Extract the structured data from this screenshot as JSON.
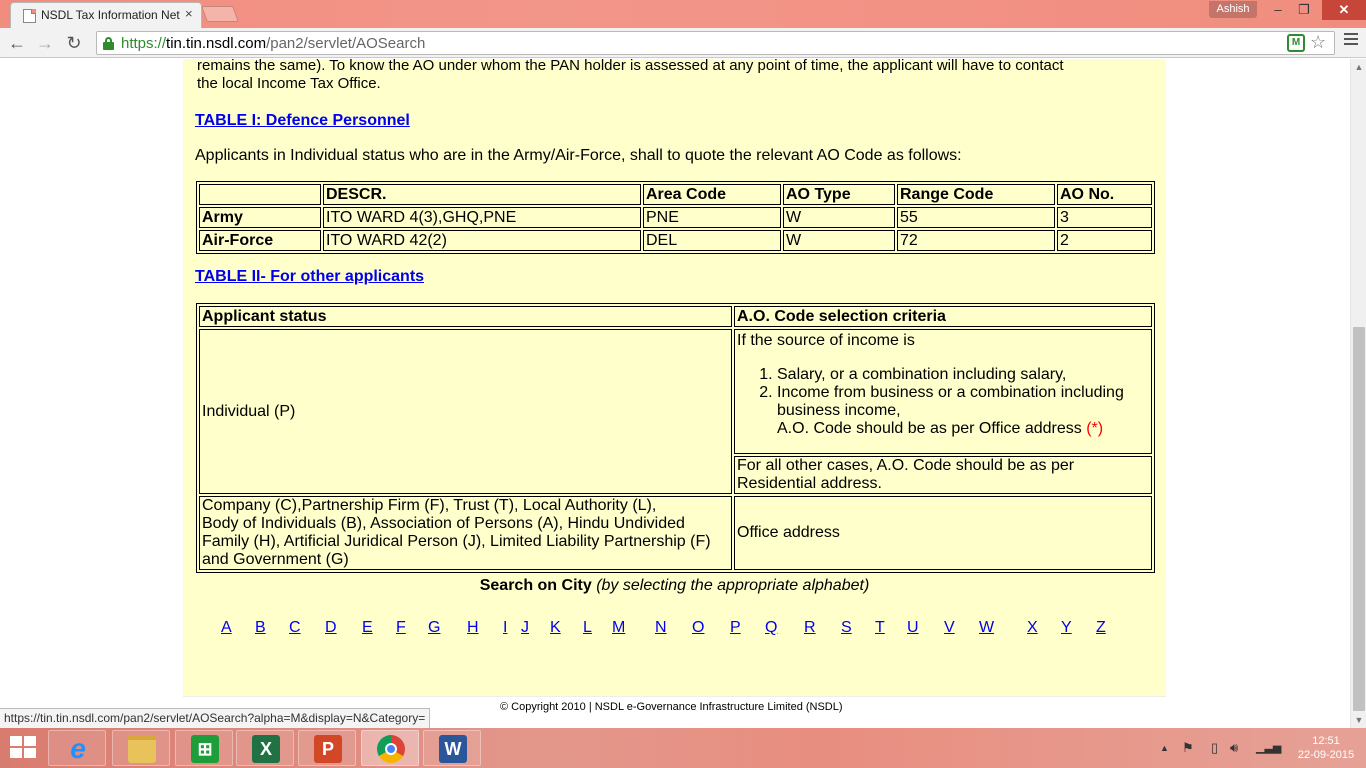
{
  "browser": {
    "tab_title": "NSDL Tax Information Net",
    "tab_close": "×",
    "user": "Ashish",
    "url_scheme": "https://",
    "url_host": "tin.tin.nsdl.com",
    "url_path": "/pan2/servlet/AOSearch",
    "status_url": "https://tin.tin.nsdl.com/pan2/servlet/AOSearch?alpha=M&display=N&Category="
  },
  "page": {
    "intro_line1": "remains the same). To know the AO under whom the PAN holder is assessed at any point of time, the applicant will have to contact",
    "intro_line2": "the local Income Tax Office.",
    "table1_heading": "TABLE I: Defence Personnel",
    "table1_para": "Applicants in Individual status who are in the Army/Air-Force, shall to quote the relevant AO Code as follows:",
    "table1": {
      "headers": [
        "",
        "DESCR.",
        "Area Code",
        "AO Type",
        "Range Code",
        "AO No."
      ],
      "rows": [
        [
          "Army",
          "ITO WARD 4(3),GHQ,PNE",
          "PNE",
          "W",
          "55",
          "3"
        ],
        [
          "Air-Force",
          "ITO WARD 42(2)",
          "DEL",
          "W",
          "72",
          "2"
        ]
      ]
    },
    "table2_heading": "TABLE II- For other applicants",
    "table2": {
      "header_status": "Applicant status",
      "header_criteria": "A.O. Code selection criteria",
      "individual": "Individual (P)",
      "source_intro": "If the source of income is",
      "list_item_1": "Salary, or a combination including salary,",
      "list_item_2": "Income from business or a combination including business income,",
      "office_note": "A.O. Code should be as per Office address",
      "office_note_mark": "(*)",
      "other_cases": "For all other cases, A.O. Code should be as per Residential address.",
      "company_line1": "Company (C),Partnership Firm (F), Trust (T), Local Authority (L),",
      "company_line2": "Body of Individuals (B), Association of Persons (A), Hindu Undivided",
      "company_line3": "Family (H), Artificial Juridical Person (J), Limited Liability Partnership (F)",
      "company_line4": "and Government (G)",
      "office_address": "Office address"
    },
    "search_bold": "Search on City",
    "search_italic": "(by selecting the appropriate alphabet)",
    "alphabet": [
      "A",
      "B",
      "C",
      "D",
      "E",
      "F",
      "G",
      "H",
      "I",
      "J",
      "K",
      "L",
      "M",
      "N",
      "O",
      "P",
      "Q",
      "R",
      "S",
      "T",
      "U",
      "V",
      "W",
      "X",
      "Y",
      "Z"
    ],
    "copyright": "© Copyright 2010  |  NSDL e-Governance Infrastructure Limited (NSDL)"
  },
  "taskbar": {
    "time": "12:51",
    "date": "22-09-2015",
    "apps": [
      "internet-explorer",
      "file-explorer",
      "windows-store",
      "excel",
      "powerpoint",
      "chrome",
      "word"
    ]
  }
}
